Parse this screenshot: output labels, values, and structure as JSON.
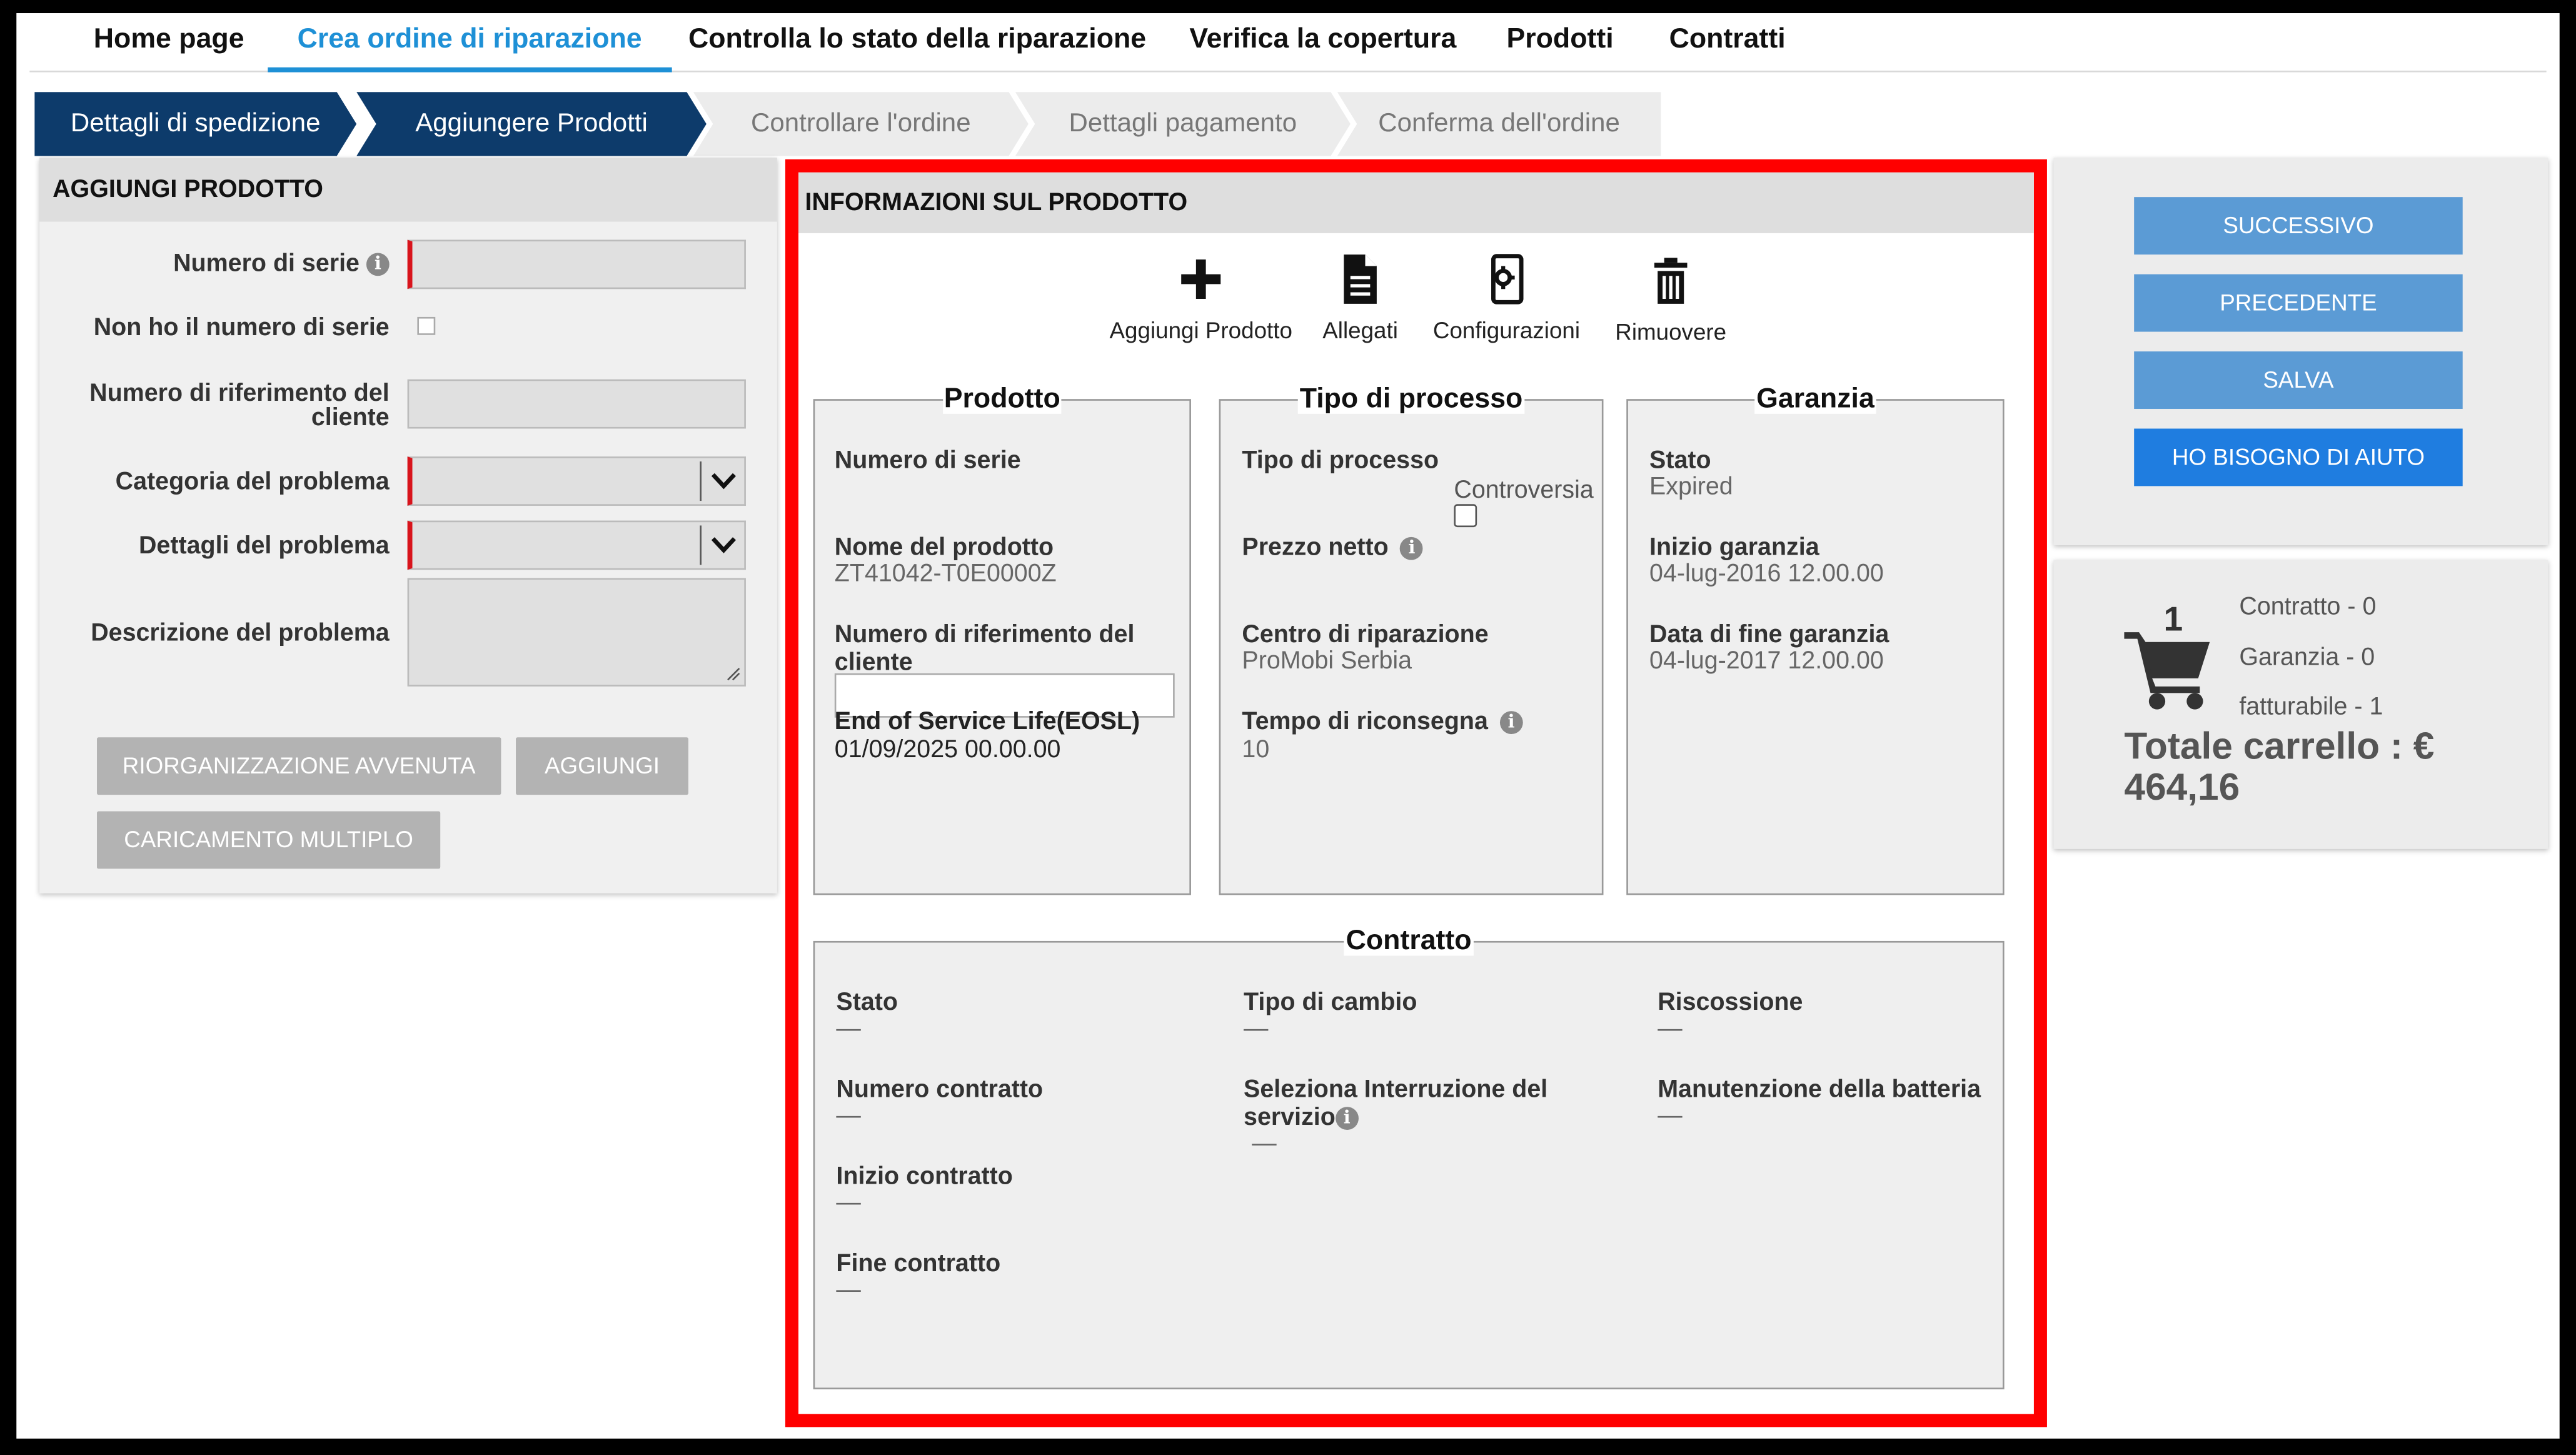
{
  "nav": {
    "items": [
      "Home page",
      "Crea ordine di riparazione",
      "Controlla lo stato della riparazione",
      "Verifica la copertura",
      "Prodotti",
      "Contratti"
    ]
  },
  "steps": [
    "Dettagli di spedizione",
    "Aggiungere Prodotti",
    "Controllare l'ordine",
    "Dettagli pagamento",
    "Conferma dell'ordine"
  ],
  "left": {
    "title": "AGGIUNGI PRODOTTO",
    "serial_label": "Numero di serie",
    "no_serial_label": "Non ho il numero di serie",
    "customer_ref_label_1": "Numero di riferimento del",
    "customer_ref_label_2": "cliente",
    "problem_category_label": "Categoria del problema",
    "problem_details_label": "Dettagli del problema",
    "problem_description_label": "Descrizione del problema",
    "btn_reorg": "RIORGANIZZAZIONE AVVENUTA",
    "btn_add": "AGGIUNGI",
    "btn_bulk": "CARICAMENTO MULTIPLO"
  },
  "center": {
    "title": "INFORMAZIONI SUL PRODOTTO",
    "tools": {
      "add": "Aggiungi Prodotto",
      "attachments": "Allegati",
      "configurations": "Configurazioni",
      "remove": "Rimuovere"
    },
    "product": {
      "title": "Prodotto",
      "serial_label": "Numero di serie",
      "name_label": "Nome del prodotto",
      "name_value": "ZT41042-T0E0000Z",
      "ref_label_1": "Numero di riferimento del",
      "ref_label_2": "cliente",
      "eosl_label": "End of Service Life(EOSL)",
      "eosl_value": "01/09/2025 00.00.00"
    },
    "process": {
      "title": "Tipo di processo",
      "type_label": "Tipo di processo",
      "dispute_label": "Controversia",
      "net_price_label": "Prezzo netto",
      "repair_center_label": "Centro di riparazione",
      "repair_center_value": "ProMobi Serbia",
      "turnaround_label": "Tempo di riconsegna",
      "turnaround_value": "10"
    },
    "warranty": {
      "title": "Garanzia",
      "status_label": "Stato",
      "status_value": "Expired",
      "start_label": "Inizio garanzia",
      "start_value": "04-lug-2016 12.00.00",
      "end_label": "Data di fine garanzia",
      "end_value": "04-lug-2017 12.00.00"
    },
    "contract": {
      "title": "Contratto",
      "status_label": "Stato",
      "status_value": "—",
      "exchange_label": "Tipo di cambio",
      "exchange_value": "—",
      "collection_label": "Riscossione",
      "collection_value": "—",
      "number_label": "Numero contratto",
      "number_value": "—",
      "interruption_label_1": "Seleziona Interruzione del",
      "interruption_label_2": "servizio",
      "interruption_value": "—",
      "battery_label": "Manutenzione della batteria",
      "battery_value": "—",
      "start_label": "Inizio contratto",
      "start_value": "—",
      "end_label": "Fine contratto",
      "end_value": "—"
    }
  },
  "right": {
    "btn_next": "SUCCESSIVO",
    "btn_prev": "PRECEDENTE",
    "btn_save": "SALVA",
    "btn_help": "HO BISOGNO DI AIUTO"
  },
  "cart": {
    "count": "1",
    "contract": "Contratto - 0",
    "warranty": "Garanzia - 0",
    "billable": "fatturabile - 1",
    "total_label": "Totale carrello : €",
    "total_value": "464,16"
  },
  "colors": {
    "nav_active": "#1e90d6",
    "step_done": "#0d3b6b",
    "highlight_border": "#ff0000",
    "button_blue": "#5b9bd5",
    "button_help": "#1f7de0"
  }
}
